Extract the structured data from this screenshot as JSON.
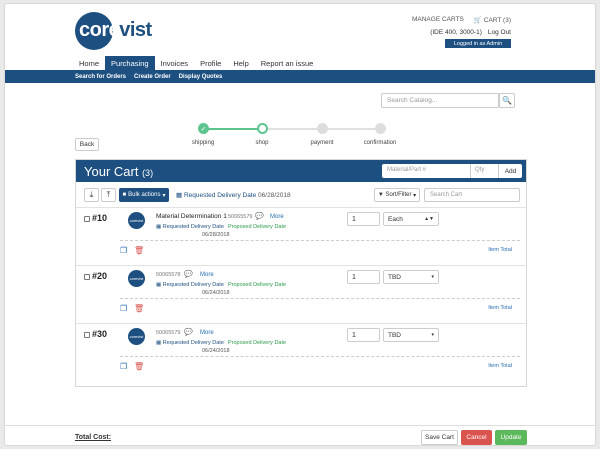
{
  "brand": {
    "logo_circle": "core",
    "logo_rest": "vist",
    "color": "#1d4f80"
  },
  "header": {
    "manage_carts": "MANAGE CARTS",
    "cart_label": "CART (3)",
    "account": "(IDE 400, 3000-1)",
    "logout": "Log Out",
    "login_badge": "Logged in as Admin"
  },
  "nav": {
    "tabs": [
      "Home",
      "Purchasing",
      "Invoices",
      "Profile",
      "Help",
      "Report an issue"
    ],
    "active": "Purchasing",
    "sub": [
      "Search for Orders",
      "Create Order",
      "Display Quotes"
    ]
  },
  "catalog": {
    "placeholder": "Search Catalog..."
  },
  "back_label": "Back",
  "steps": [
    {
      "label": "shipping",
      "state": "done"
    },
    {
      "label": "shop",
      "state": "current"
    },
    {
      "label": "payment",
      "state": "todo"
    },
    {
      "label": "confirmation",
      "state": "todo"
    }
  ],
  "cart": {
    "title": "Your Cart",
    "count": "(3)",
    "part_placeholder": "Material/Part #",
    "qty_placeholder": "Qty",
    "add_label": "Add",
    "bulk_label": "Bulk actions",
    "req_label": "Requested Delivery Date",
    "req_value": "06/28/2018",
    "sort_label": "Sort/Filter",
    "search_placeholder": "Search Cart",
    "items": [
      {
        "line": "#10",
        "name": "Material Determination 1",
        "number": "50065579",
        "more": "More",
        "req_label": "Requested Delivery Date",
        "date": "06/28/2018",
        "proposed": "Proposed Delivery Date",
        "qty": "1",
        "uom": "Each",
        "item_total": "Item Total"
      },
      {
        "line": "#20",
        "name": "",
        "number": "50065578",
        "more": "More",
        "req_label": "Requested Delivery Date",
        "date": "06/24/2018",
        "proposed": "Proposed Delivery Date",
        "qty": "1",
        "uom": "TBD",
        "item_total": "Item Total"
      },
      {
        "line": "#30",
        "name": "",
        "number": "50065579",
        "more": "More",
        "req_label": "Requested Delivery Date",
        "date": "06/24/2018",
        "proposed": "Proposed Delivery Date",
        "qty": "1",
        "uom": "TBD",
        "item_total": "Item Total"
      }
    ]
  },
  "footer": {
    "total_cost": "Total Cost:",
    "save": "Save Cart",
    "cancel": "Cancel",
    "update": "Update"
  }
}
